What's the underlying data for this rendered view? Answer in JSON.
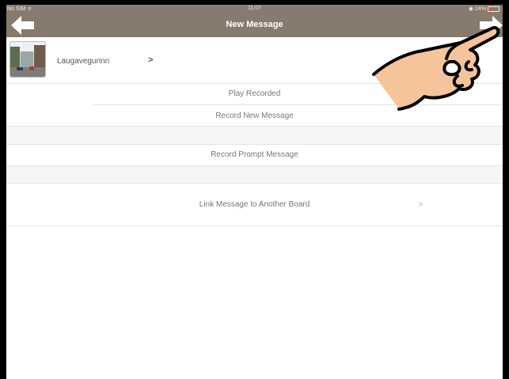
{
  "status_bar": {
    "carrier": "No SIM",
    "wifi_icon": "wifi-icon",
    "time": "11:07",
    "location_icon": "location-icon",
    "battery": "24%"
  },
  "navbar": {
    "title": "New Message",
    "back_icon": "back-arrow-icon",
    "forward_icon": "forward-arrow-icon",
    "background": "#877a6e"
  },
  "board": {
    "name": "Laugavegurinn",
    "chevron": ">"
  },
  "actions": {
    "play_recorded": "Play Recorded",
    "record_new": "Record New Message",
    "record_prompt": "Record Prompt Message",
    "link_board": "Link Message to Another Board",
    "link_chevron": ">"
  },
  "overlay": {
    "icon": "pointing-hand-icon"
  }
}
